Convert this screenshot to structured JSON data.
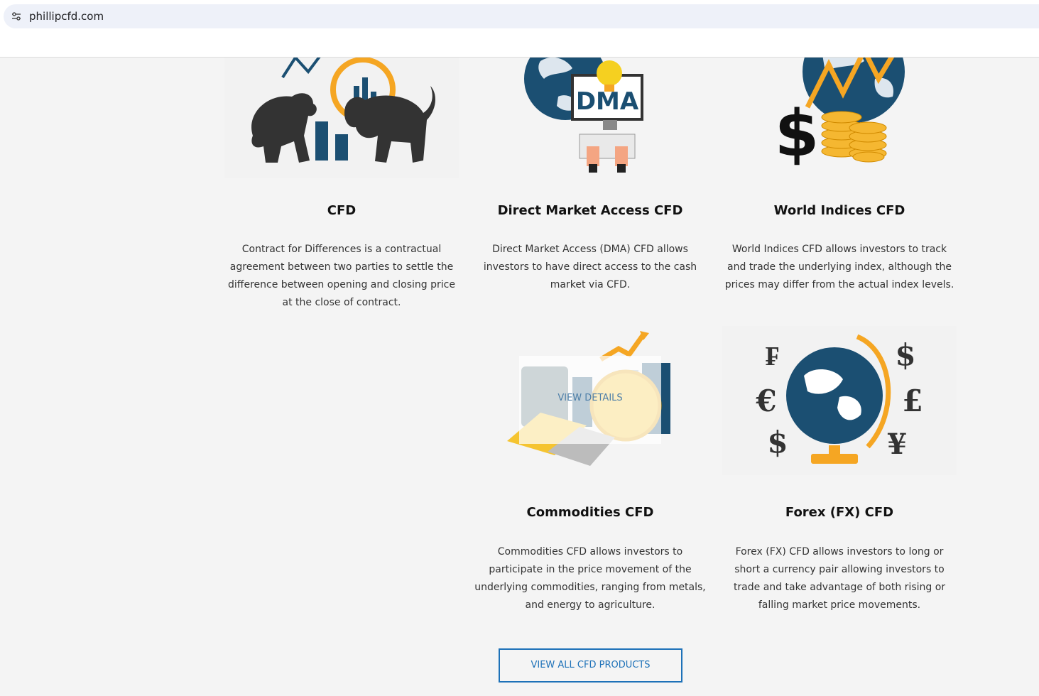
{
  "browser": {
    "url": "phillipcfd.com",
    "site_icon": "tune-icon"
  },
  "products": [
    {
      "title": "CFD",
      "description": "Contract for Differences is a contractual agreement between two parties to settle the difference between opening and closing price at the close of contract.",
      "icon": "bull-bear-icon"
    },
    {
      "title": "Direct Market Access CFD",
      "description": "Direct Market Access (DMA) CFD allows investors to have direct access to the cash market via CFD.",
      "icon": "dma-computer-icon",
      "icon_text": "DMA"
    },
    {
      "title": "World Indices CFD",
      "description": "World Indices CFD allows investors to track and trade the underlying index, although the prices may differ from the actual index levels.",
      "icon": "globe-coins-icon"
    },
    {
      "title": "Commodities CFD",
      "description": "Commodities CFD allows investors to participate in the price movement of the underlying commodities, ranging from metals, and energy to agriculture.",
      "icon": "commodities-icon",
      "hover_label": "VIEW DETAILS"
    },
    {
      "title": "Forex (FX) CFD",
      "description": "Forex (FX) CFD allows investors to long or short a currency pair allowing investors to trade and take advantage of both rising or falling market price movements.",
      "icon": "currency-globe-icon"
    }
  ],
  "cta": {
    "label": "VIEW ALL CFD PRODUCTS"
  },
  "colors": {
    "accent_blue": "#1d71b8",
    "navy": "#1b4f72",
    "gold": "#f5a623",
    "dark": "#333333"
  }
}
